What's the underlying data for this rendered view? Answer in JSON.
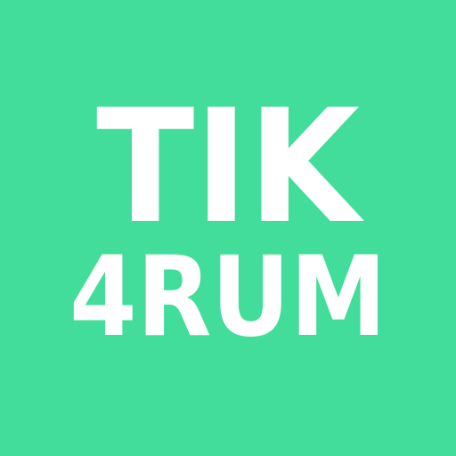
{
  "logo": {
    "line1": "TIK",
    "line2": "4RUM",
    "background_color": "#43DD9B",
    "text_color": "#FFFFFF"
  }
}
